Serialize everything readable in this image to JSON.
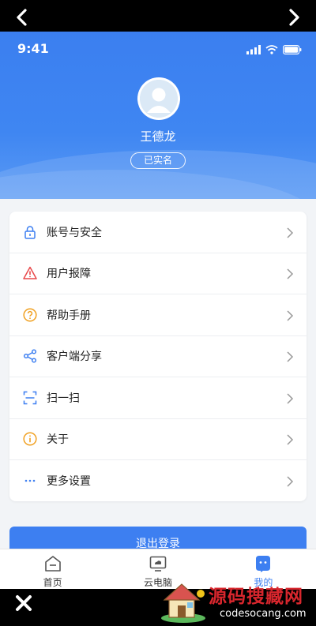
{
  "status_bar": {
    "time": "9:41"
  },
  "profile": {
    "name": "王德龙",
    "verify_badge": "已实名"
  },
  "menu": {
    "items": [
      {
        "label": "账号与安全",
        "icon": "lock-icon",
        "icon_color": "#3d7ff1"
      },
      {
        "label": "用户报障",
        "icon": "warning-icon",
        "icon_color": "#e8484a"
      },
      {
        "label": "帮助手册",
        "icon": "help-icon",
        "icon_color": "#f0a020"
      },
      {
        "label": "客户端分享",
        "icon": "share-icon",
        "icon_color": "#3d7ff1"
      },
      {
        "label": "扫一扫",
        "icon": "scan-icon",
        "icon_color": "#3d7ff1"
      },
      {
        "label": "关于",
        "icon": "info-icon",
        "icon_color": "#f0a020"
      },
      {
        "label": "更多设置",
        "icon": "more-icon",
        "icon_color": "#3d7ff1"
      }
    ]
  },
  "logout": {
    "label": "退出登录"
  },
  "tabs": [
    {
      "label": "首页",
      "icon": "home-icon",
      "active": false
    },
    {
      "label": "云电脑",
      "icon": "cloud-pc-icon",
      "active": false
    },
    {
      "label": "我的",
      "icon": "profile-icon",
      "active": true
    }
  ],
  "watermark": {
    "title": "源码搜藏网",
    "url": "codesocang.com"
  },
  "colors": {
    "accent": "#3d7ff1",
    "header_top": "#3b7ff0",
    "background": "#f2f4f7"
  }
}
